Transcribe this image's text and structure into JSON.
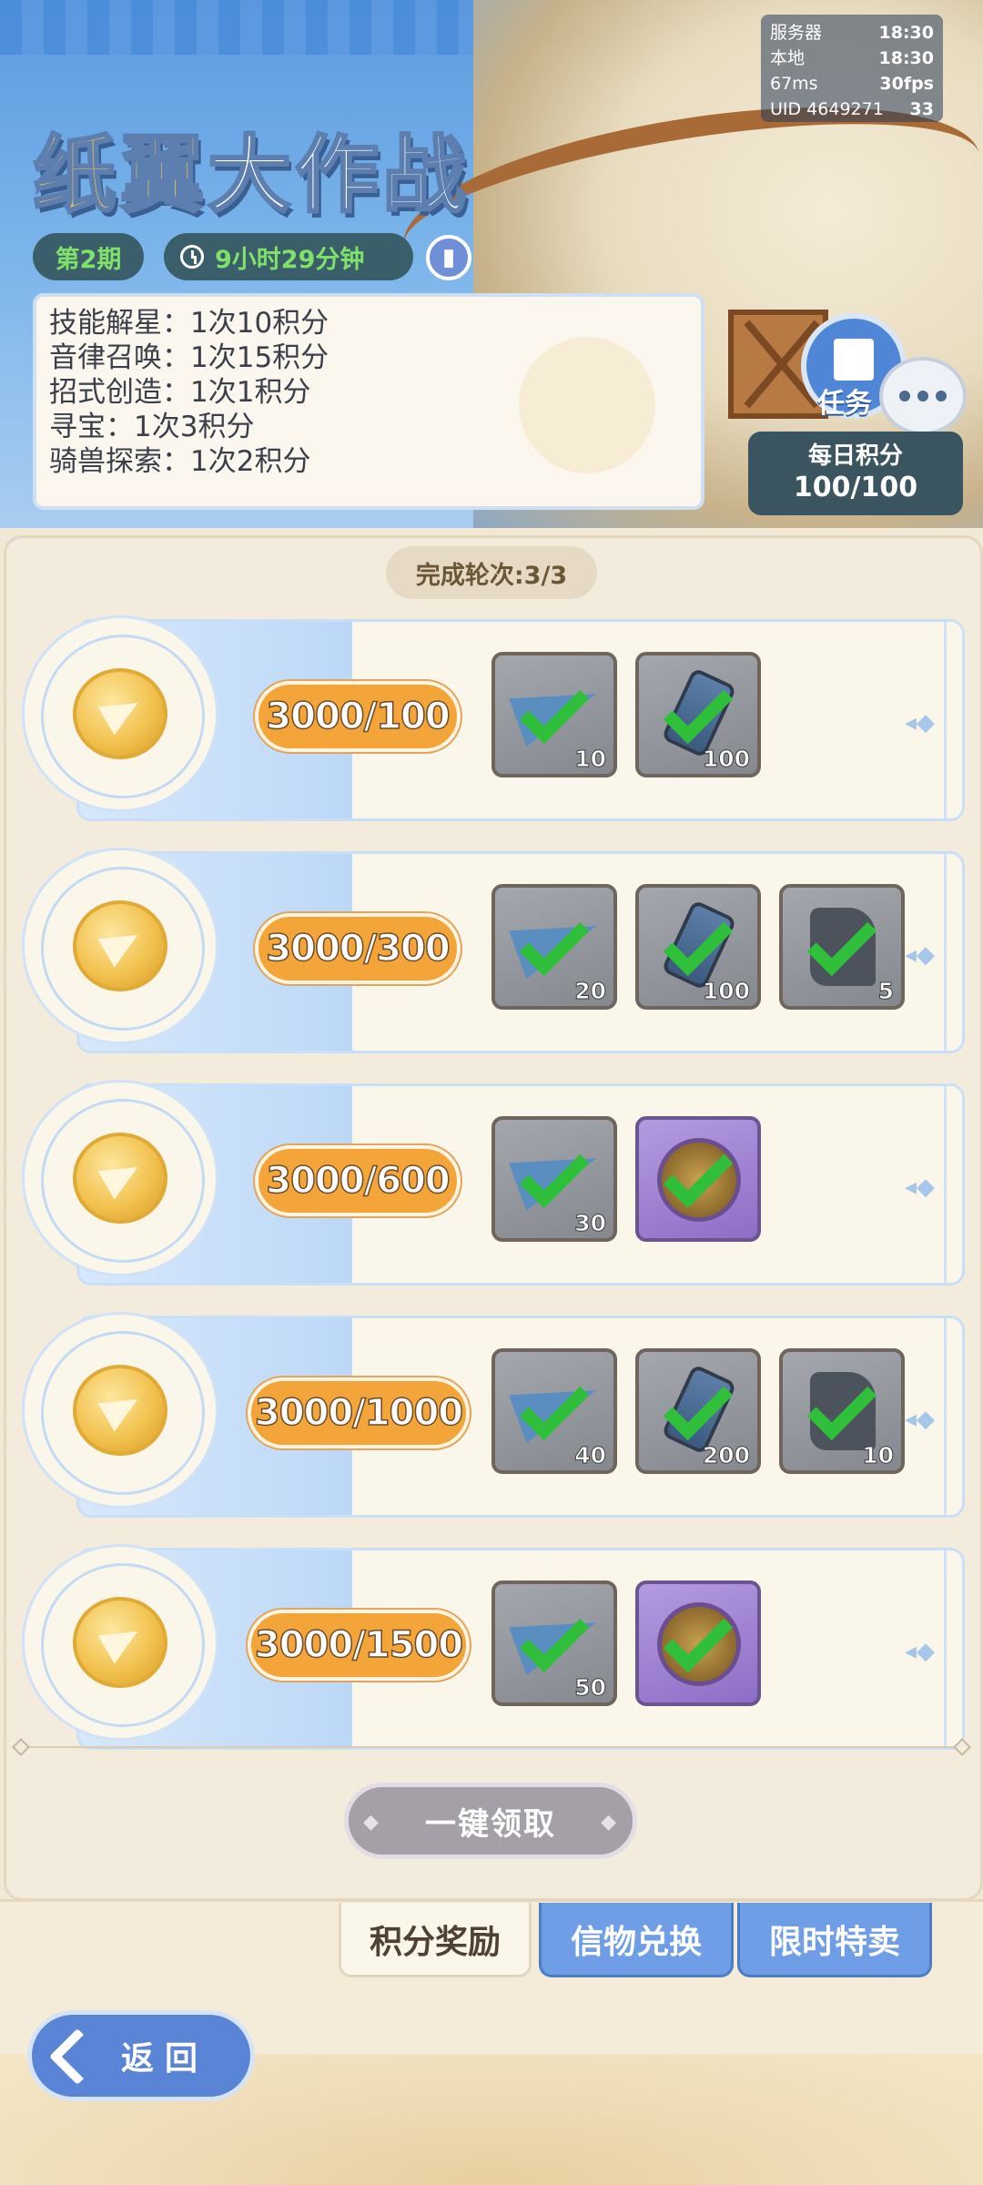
{
  "status": {
    "server_label": "服务器",
    "server_time": "18:30",
    "local_label": "本地",
    "local_time": "18:30",
    "ping": "67ms",
    "fps": "30fps",
    "uid": "UID 4649271",
    "battery": "33"
  },
  "header": {
    "title_part_a": "纸翼",
    "title_part_b": "大作战",
    "period": "第2期",
    "timer": "9小时29分钟"
  },
  "rules": [
    "技能解星：1次10积分",
    "音律召唤：1次15积分",
    "招式创造：1次1积分",
    "寻宝：1次3积分",
    "骑兽探索：1次2积分"
  ],
  "task": {
    "label": "任务"
  },
  "daily": {
    "label": "每日积分",
    "value": "100/100"
  },
  "rounds": "完成轮次:3/3",
  "tiers": [
    {
      "score": "3000/100",
      "rewards": [
        {
          "icon": "paper-plane-icon",
          "qty": "10"
        },
        {
          "icon": "ink-canister-icon",
          "qty": "100"
        }
      ]
    },
    {
      "score": "3000/300",
      "rewards": [
        {
          "icon": "paper-plane-icon",
          "qty": "20"
        },
        {
          "icon": "ink-canister-icon",
          "qty": "100"
        },
        {
          "icon": "stone-fire-icon",
          "qty": "5"
        }
      ]
    },
    {
      "score": "3000/600",
      "rewards": [
        {
          "icon": "paper-plane-icon",
          "qty": "30"
        },
        {
          "icon": "gold-coin-icon",
          "qty": ""
        }
      ]
    },
    {
      "score": "3000/1000",
      "rewards": [
        {
          "icon": "paper-plane-icon",
          "qty": "40"
        },
        {
          "icon": "ink-canister-icon",
          "qty": "200"
        },
        {
          "icon": "stone-fire-icon",
          "qty": "10"
        }
      ]
    },
    {
      "score": "3000/1500",
      "rewards": [
        {
          "icon": "paper-plane-icon",
          "qty": "50"
        },
        {
          "icon": "glider-emblem-icon",
          "qty": ""
        }
      ]
    }
  ],
  "claim_all": "一键领取",
  "tabs": [
    "积分奖励",
    "信物兑换",
    "限时特卖"
  ],
  "back": "返回",
  "colors": {
    "accent_blue": "#5a85d6",
    "score_orange": "#f4a53a",
    "check_green": "#2fbf3b",
    "badge_green": "#7fe06a"
  }
}
